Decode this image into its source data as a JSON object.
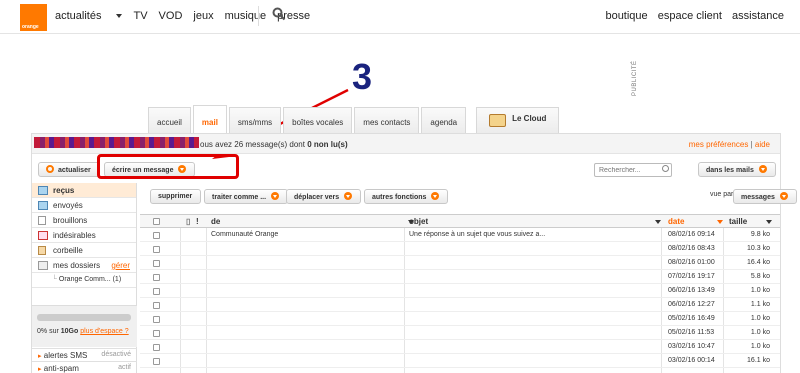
{
  "brand": {
    "logo_text": "orange",
    "color": "#ff7900"
  },
  "topnav": {
    "items": [
      "actualités",
      "TV",
      "VOD",
      "jeux",
      "musique",
      "presse"
    ],
    "right_items": [
      "boutique",
      "espace client",
      "assistance"
    ]
  },
  "ad_label": "PUBLICITÉ",
  "annotation_number": "3",
  "tabs": [
    {
      "label": "accueil",
      "active": false
    },
    {
      "label": "mail",
      "active": true
    },
    {
      "label": "sms/mms",
      "active": false
    },
    {
      "label": "boîtes vocales",
      "active": false
    },
    {
      "label": "mes contacts",
      "active": false
    },
    {
      "label": "agenda",
      "active": false
    },
    {
      "label": "Le Cloud",
      "active": false
    }
  ],
  "infobar": {
    "text_prefix": "ous avez 26 message(s) dont",
    "unread": "0 non lu(s)",
    "prefs": "mes préférences",
    "sep": "|",
    "help": "aide"
  },
  "toolbar": {
    "refresh": "actualiser",
    "compose": "écrire un message",
    "search_placeholder": "Rechercher...",
    "scope": "dans les mails"
  },
  "sidebar": {
    "items": [
      {
        "label": "reçus",
        "active": true,
        "icon": "inbox-icon"
      },
      {
        "label": "envoyés",
        "active": false,
        "icon": "sent-icon"
      },
      {
        "label": "brouillons",
        "active": false,
        "icon": "draft-icon"
      },
      {
        "label": "indésirables",
        "active": false,
        "icon": "spam-icon"
      },
      {
        "label": "corbeille",
        "active": false,
        "icon": "trash-icon"
      },
      {
        "label": "mes dossiers",
        "active": false,
        "icon": "folder-icon"
      }
    ],
    "manage": "gérer",
    "subfolder": "Orange Comm... (1)",
    "quota_used": "0%",
    "quota_of": "sur",
    "quota_total": "10Go",
    "quota_more": "plus d'espace ?",
    "sms_alerts": "alertes SMS",
    "sms_status": "désactivé",
    "antispam": "anti-spam",
    "antispam_status": "actif"
  },
  "mail_actions": {
    "delete": "supprimer",
    "process": "traiter comme ...",
    "move": "déplacer vers",
    "other": "autres fonctions",
    "view_by": "vue par",
    "view_mode": "messages"
  },
  "columns": {
    "from": "de",
    "subject": "objet",
    "date": "date",
    "size": "taille"
  },
  "messages": [
    {
      "from": "Communauté Orange",
      "subject": "Une réponse à un sujet que vous suivez a...",
      "date": "08/02/16 09:14",
      "size": "9.8 ko"
    },
    {
      "from": "",
      "subject": "",
      "date": "08/02/16 08:43",
      "size": "10.3 ko"
    },
    {
      "from": "",
      "subject": "",
      "date": "08/02/16 01:00",
      "size": "16.4 ko"
    },
    {
      "from": "",
      "subject": "",
      "date": "07/02/16 19:17",
      "size": "5.8 ko"
    },
    {
      "from": "",
      "subject": "",
      "date": "06/02/16 13:49",
      "size": "1.0 ko"
    },
    {
      "from": "",
      "subject": "",
      "date": "06/02/16 12:27",
      "size": "1.1 ko"
    },
    {
      "from": "",
      "subject": "",
      "date": "05/02/16 16:49",
      "size": "1.0 ko"
    },
    {
      "from": "",
      "subject": "",
      "date": "05/02/16 11:53",
      "size": "1.0 ko"
    },
    {
      "from": "",
      "subject": "",
      "date": "03/02/16 10:47",
      "size": "1.0 ko"
    },
    {
      "from": "",
      "subject": "",
      "date": "03/02/16 00:14",
      "size": "16.1 ko"
    }
  ]
}
